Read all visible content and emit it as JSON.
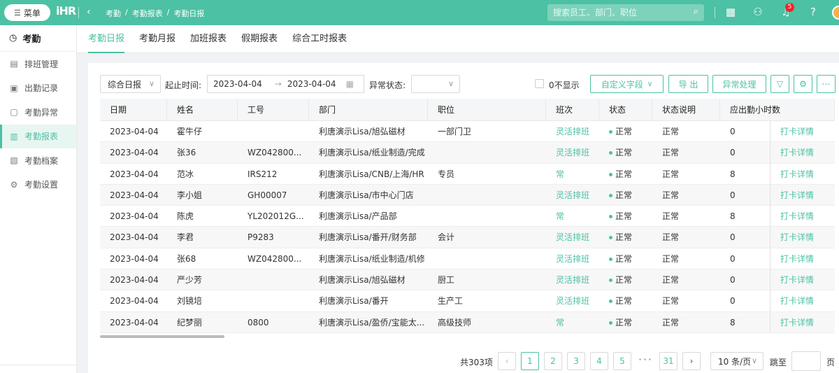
{
  "topbar": {
    "menu_label": "菜单",
    "logo_text": "iHR",
    "breadcrumb": [
      "考勤",
      "/",
      "考勤报表",
      "/",
      "考勤日报"
    ],
    "search_placeholder": "搜索员工、部门、职位",
    "notification_count": "5",
    "accent_color": "#4cc1a3"
  },
  "sidebar": {
    "title": "考勤",
    "items": [
      {
        "label": "排班管理",
        "icon": "calendar-icon"
      },
      {
        "label": "出勤记录",
        "icon": "record-icon"
      },
      {
        "label": "考勤异常",
        "icon": "exception-icon"
      },
      {
        "label": "考勤报表",
        "icon": "chart-icon"
      },
      {
        "label": "考勤档案",
        "icon": "file-icon"
      },
      {
        "label": "考勤设置",
        "icon": "gear-icon"
      }
    ]
  },
  "tabs": [
    "考勤日报",
    "考勤月报",
    "加班报表",
    "假期报表",
    "综合工时报表"
  ],
  "filters": {
    "report_type": "综合日报",
    "range_label": "起止时间:",
    "start_date": "2023-04-04",
    "end_date": "2023-04-04",
    "status_label": "异常状态:",
    "zero_hide_label": "0不显示",
    "custom_fields": "自定义字段",
    "export": "导 出",
    "exception_handle": "异常处理"
  },
  "table": {
    "columns": [
      "日期",
      "姓名",
      "工号",
      "部门",
      "职位",
      "班次",
      "状态",
      "状态说明",
      "应出勤小时数"
    ],
    "rows": [
      [
        "2023-04-04",
        "霍牛仔",
        "",
        "利唐演示Lisa/旭弘磁材",
        "一部门卫",
        "灵活排班",
        "正常",
        "正常",
        "0",
        "打卡详情"
      ],
      [
        "2023-04-04",
        "张36",
        "WZ042800...",
        "利唐演示Lisa/纸业制造/完成",
        "",
        "灵活排班",
        "正常",
        "正常",
        "0",
        "打卡详情"
      ],
      [
        "2023-04-04",
        "范冰",
        "IRS212",
        "利唐演示Lisa/CNB/上海/HR",
        "专员",
        "常",
        "正常",
        "正常",
        "8",
        "打卡详情"
      ],
      [
        "2023-04-04",
        "李小姐",
        "GH00007",
        "利唐演示Lisa/市中心门店",
        "",
        "灵活排班",
        "正常",
        "正常",
        "0",
        "打卡详情"
      ],
      [
        "2023-04-04",
        "陈虎",
        "YL202012G...",
        "利唐演示Lisa/产品部",
        "",
        "常",
        "正常",
        "正常",
        "8",
        "打卡详情"
      ],
      [
        "2023-04-04",
        "李君",
        "P9283",
        "利唐演示Lisa/番开/财务部",
        "会计",
        "灵活排班",
        "正常",
        "正常",
        "0",
        "打卡详情"
      ],
      [
        "2023-04-04",
        "张68",
        "WZ042800...",
        "利唐演示Lisa/纸业制造/机修",
        "",
        "灵活排班",
        "正常",
        "正常",
        "0",
        "打卡详情"
      ],
      [
        "2023-04-04",
        "严少芳",
        "",
        "利唐演示Lisa/旭弘磁材",
        "厨工",
        "灵活排班",
        "正常",
        "正常",
        "0",
        "打卡详情"
      ],
      [
        "2023-04-04",
        "刘镜培",
        "",
        "利唐演示Lisa/番开",
        "生产工",
        "灵活排班",
        "正常",
        "正常",
        "0",
        "打卡详情"
      ],
      [
        "2023-04-04",
        "纪梦丽",
        "0800",
        "利唐演示Lisa/盈侨/宝能太...",
        "高级技师",
        "常",
        "正常",
        "正常",
        "8",
        "打卡详情"
      ]
    ]
  },
  "pagination": {
    "total": "共303项",
    "pages": [
      "1",
      "2",
      "3",
      "4",
      "5"
    ],
    "ellipsis": "•••",
    "last_page": "31",
    "page_size": "10 条/页",
    "jump_label": "跳至",
    "page_unit": "页"
  }
}
